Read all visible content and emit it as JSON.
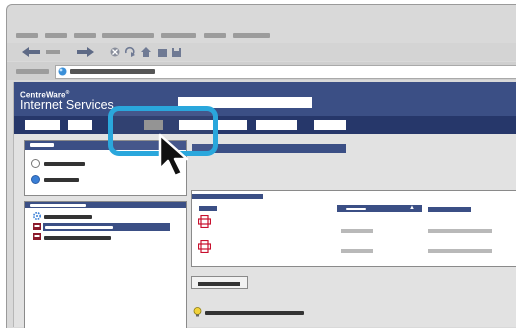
{
  "app": {
    "brand_name": "CentreWare",
    "brand_mark": "®",
    "brand_subtitle": "Internet Services"
  },
  "colors": {
    "header_bg": "#3b4f85",
    "tab_strip_bg": "#26376a",
    "highlight": "#2aa7dc",
    "content_bg": "#e2e2e2",
    "doc_icon": "#c8102e"
  },
  "browser": {
    "toolbar_icons": [
      "back-arrow-icon",
      "forward-arrow-icon",
      "stop-icon",
      "refresh-icon",
      "home-icon",
      "folder-icon",
      "print-icon"
    ],
    "address_icon": "globe-icon"
  },
  "tabs": {
    "count": 7,
    "active_index": 2
  },
  "left_panels": {
    "options": {
      "radio_count": 2,
      "selected_index": 1
    },
    "tree": {
      "icons": [
        "gear-icon",
        "printer-icon",
        "printer-icon"
      ],
      "selected_index": 1
    }
  },
  "table": {
    "sort_indicator": "▲",
    "rows": [
      {
        "icon": "document-icon"
      },
      {
        "icon": "document-icon"
      }
    ]
  },
  "footer": {
    "info_icon": "info-bulb-icon"
  }
}
